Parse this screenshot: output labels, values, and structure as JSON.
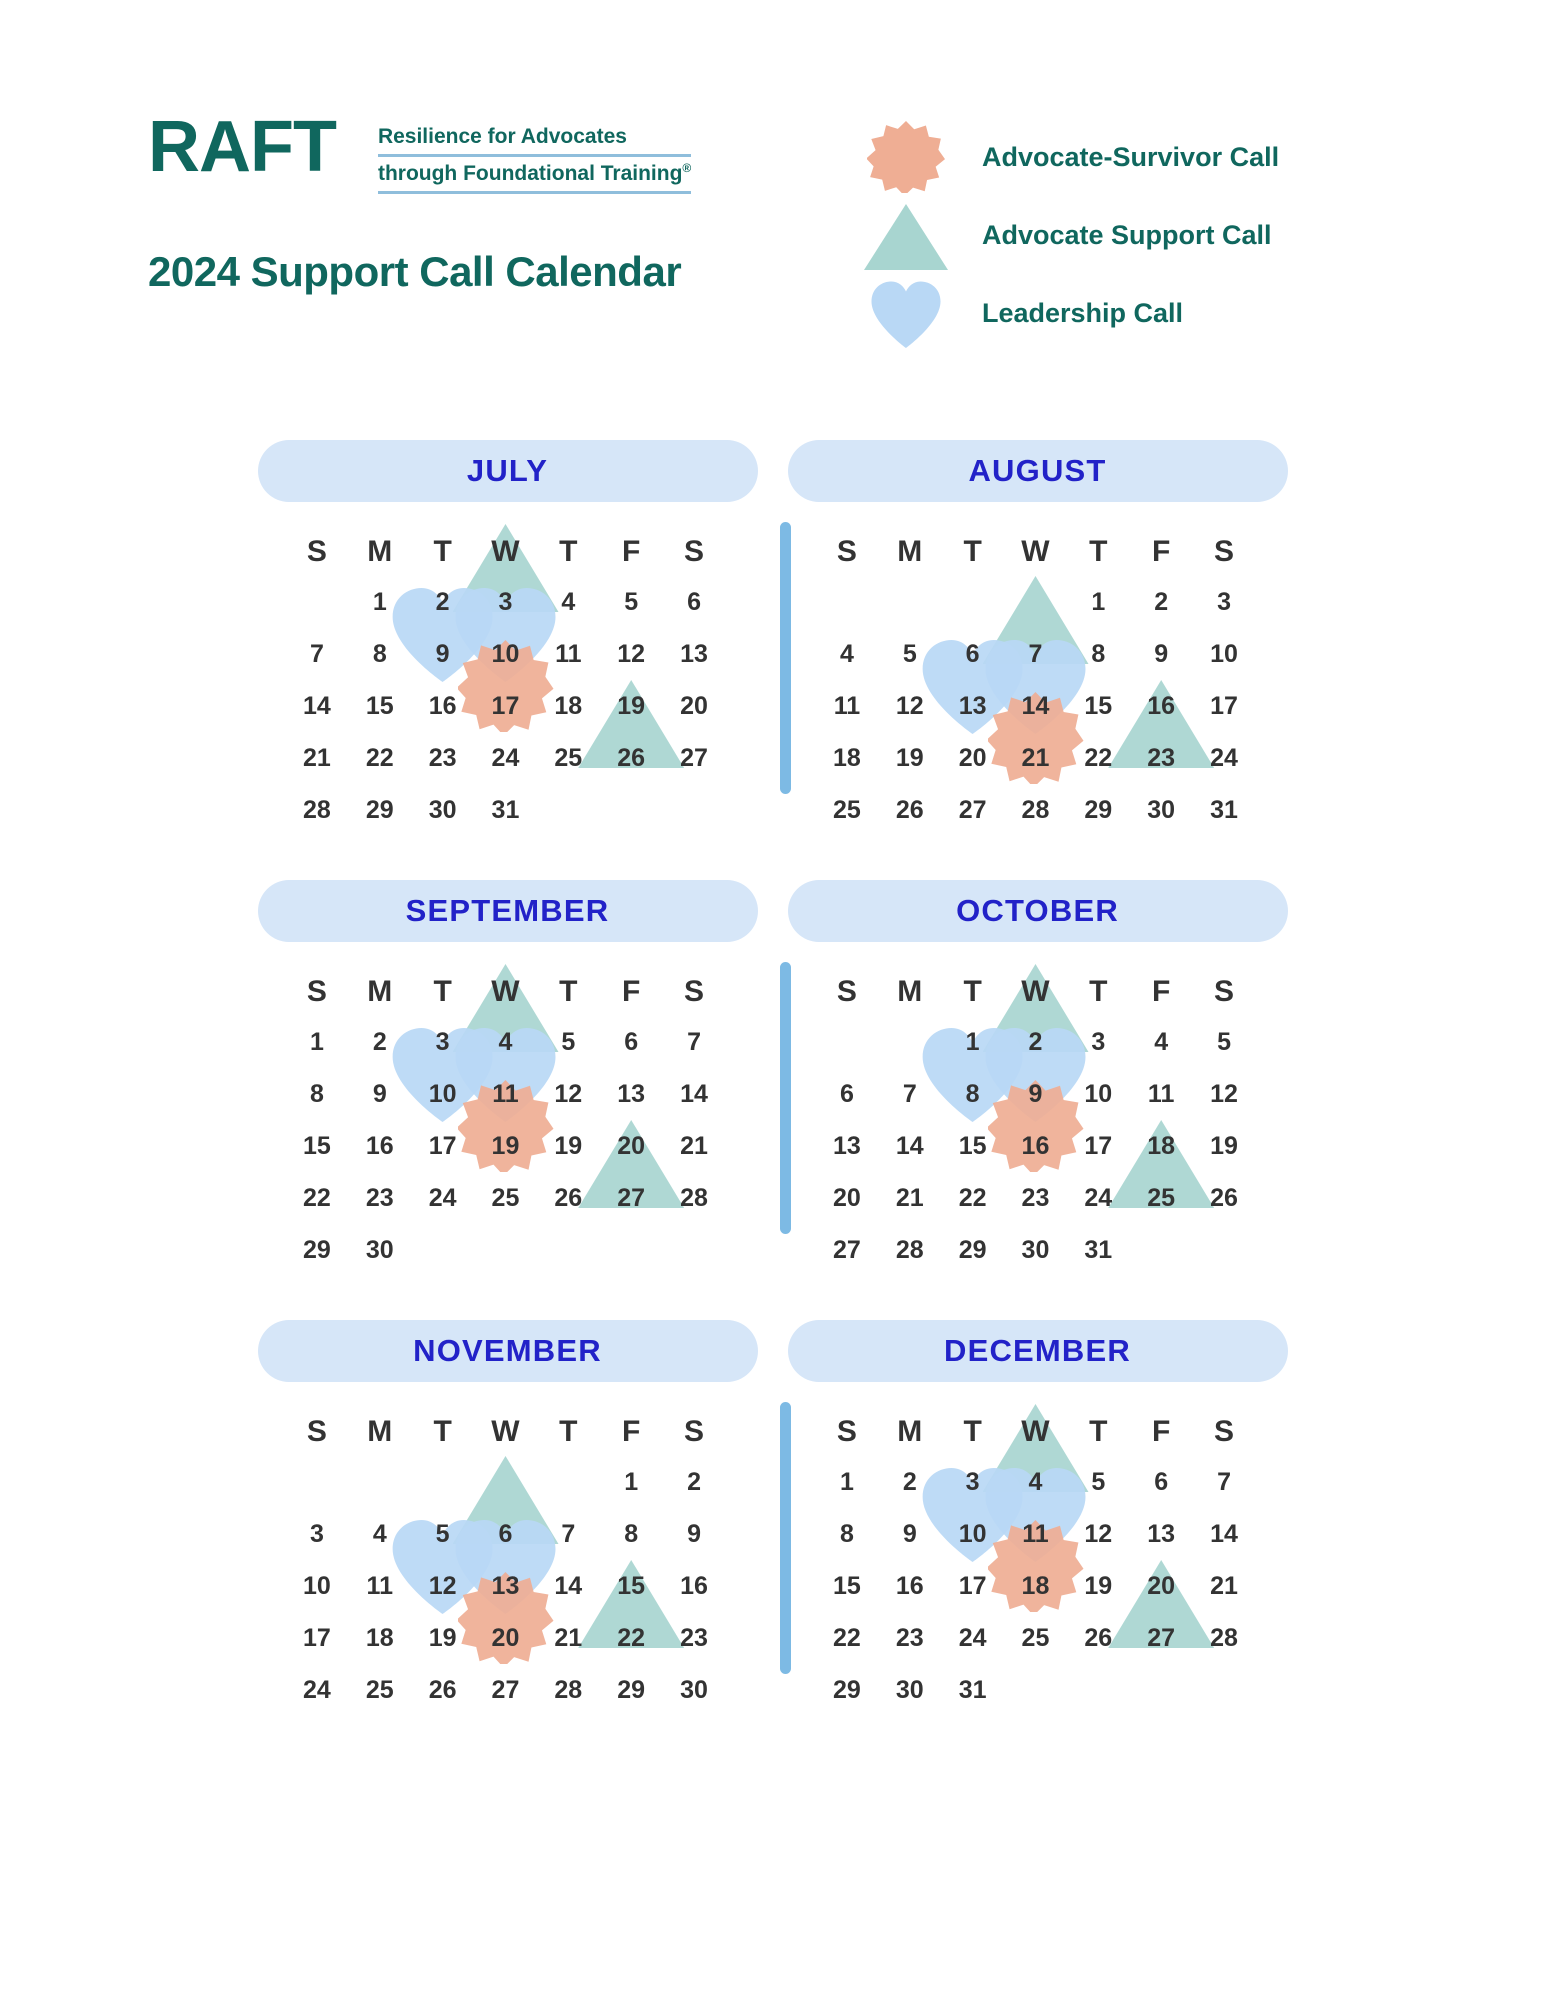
{
  "brand": {
    "logo_text": "RAFT",
    "tagline_line1": "Resilience for Advocates",
    "tagline_line2": "through Foundational Training",
    "tagline_registered": "®"
  },
  "page_title": "2024 Support Call Calendar",
  "colors": {
    "brand_teal": "#10675E",
    "month_pill_bg": "#D6E6F8",
    "month_name": "#2222C8",
    "divider": "#7DBAE4",
    "starburst": "#EFAE94",
    "triangle": "#A8D5D0",
    "heart": "#B9D8F5",
    "day_text": "#333333",
    "tagline_rule": "#8FBEDC"
  },
  "legend": {
    "items": [
      {
        "icon": "starburst-icon",
        "label": "Advocate-Survivor Call",
        "color": "#EFAE94"
      },
      {
        "icon": "triangle-icon",
        "label": "Advocate Support Call",
        "color": "#A8D5D0"
      },
      {
        "icon": "heart-icon",
        "label": "Leadership Call",
        "color": "#B9D8F5"
      }
    ]
  },
  "weekday_headers": [
    "S",
    "M",
    "T",
    "W",
    "T",
    "F",
    "S"
  ],
  "months": [
    {
      "name": "JULY",
      "has_divider": false,
      "weeks": [
        [
          "",
          "1",
          "2",
          "3",
          "4",
          "5",
          "6"
        ],
        [
          "7",
          "8",
          "9",
          "10",
          "11",
          "12",
          "13"
        ],
        [
          "14",
          "15",
          "16",
          "17",
          "18",
          "19",
          "20"
        ],
        [
          "21",
          "22",
          "23",
          "24",
          "25",
          "26",
          "27"
        ],
        [
          "28",
          "29",
          "30",
          "31",
          "",
          "",
          ""
        ]
      ],
      "markers": [
        {
          "type": "triangle",
          "day": "3",
          "row": 0,
          "col": 3
        },
        {
          "type": "heart",
          "day": "9",
          "row": 1,
          "col": 2
        },
        {
          "type": "heart",
          "day": "10",
          "row": 1,
          "col": 3
        },
        {
          "type": "starburst",
          "day": "17",
          "row": 2,
          "col": 3
        },
        {
          "type": "triangle",
          "day": "26",
          "row": 3,
          "col": 5
        }
      ]
    },
    {
      "name": "AUGUST",
      "has_divider": true,
      "weeks": [
        [
          "",
          "",
          "",
          "",
          "1",
          "2",
          "3"
        ],
        [
          "4",
          "5",
          "6",
          "7",
          "8",
          "9",
          "10"
        ],
        [
          "11",
          "12",
          "13",
          "14",
          "15",
          "16",
          "17"
        ],
        [
          "18",
          "19",
          "20",
          "21",
          "22",
          "23",
          "24"
        ],
        [
          "25",
          "26",
          "27",
          "28",
          "29",
          "30",
          "31"
        ]
      ],
      "markers": [
        {
          "type": "triangle",
          "day": "7",
          "row": 1,
          "col": 3
        },
        {
          "type": "heart",
          "day": "13",
          "row": 2,
          "col": 2
        },
        {
          "type": "heart",
          "day": "14",
          "row": 2,
          "col": 3
        },
        {
          "type": "starburst",
          "day": "21",
          "row": 3,
          "col": 3
        },
        {
          "type": "triangle",
          "day": "23",
          "row": 3,
          "col": 5
        }
      ]
    },
    {
      "name": "SEPTEMBER",
      "has_divider": false,
      "weeks": [
        [
          "1",
          "2",
          "3",
          "4",
          "5",
          "6",
          "7"
        ],
        [
          "8",
          "9",
          "10",
          "11",
          "12",
          "13",
          "14"
        ],
        [
          "15",
          "16",
          "17",
          "19",
          "19",
          "20",
          "21"
        ],
        [
          "22",
          "23",
          "24",
          "25",
          "26",
          "27",
          "28"
        ],
        [
          "29",
          "30",
          "",
          "",
          "",
          "",
          ""
        ]
      ],
      "markers": [
        {
          "type": "triangle",
          "day": "4",
          "row": 0,
          "col": 3
        },
        {
          "type": "heart",
          "day": "10",
          "row": 1,
          "col": 2
        },
        {
          "type": "heart",
          "day": "11",
          "row": 1,
          "col": 3
        },
        {
          "type": "starburst",
          "day": "19",
          "row": 2,
          "col": 3
        },
        {
          "type": "triangle",
          "day": "27",
          "row": 3,
          "col": 5
        }
      ]
    },
    {
      "name": "OCTOBER",
      "has_divider": true,
      "weeks": [
        [
          "",
          "",
          "1",
          "2",
          "3",
          "4",
          "5"
        ],
        [
          "6",
          "7",
          "8",
          "9",
          "10",
          "11",
          "12"
        ],
        [
          "13",
          "14",
          "15",
          "16",
          "17",
          "18",
          "19"
        ],
        [
          "20",
          "21",
          "22",
          "23",
          "24",
          "25",
          "26"
        ],
        [
          "27",
          "28",
          "29",
          "30",
          "31",
          "",
          ""
        ]
      ],
      "markers": [
        {
          "type": "triangle",
          "day": "2",
          "row": 0,
          "col": 3
        },
        {
          "type": "heart",
          "day": "8",
          "row": 1,
          "col": 2
        },
        {
          "type": "heart",
          "day": "9",
          "row": 1,
          "col": 3
        },
        {
          "type": "starburst",
          "day": "16",
          "row": 2,
          "col": 3
        },
        {
          "type": "triangle",
          "day": "25",
          "row": 3,
          "col": 5
        }
      ]
    },
    {
      "name": "NOVEMBER",
      "has_divider": false,
      "weeks": [
        [
          "",
          "",
          "",
          "",
          "",
          "1",
          "2"
        ],
        [
          "3",
          "4",
          "5",
          "6",
          "7",
          "8",
          "9"
        ],
        [
          "10",
          "11",
          "12",
          "13",
          "14",
          "15",
          "16"
        ],
        [
          "17",
          "18",
          "19",
          "20",
          "21",
          "22",
          "23"
        ],
        [
          "24",
          "25",
          "26",
          "27",
          "28",
          "29",
          "30"
        ]
      ],
      "markers": [
        {
          "type": "triangle",
          "day": "6",
          "row": 1,
          "col": 3
        },
        {
          "type": "heart",
          "day": "12",
          "row": 2,
          "col": 2
        },
        {
          "type": "heart",
          "day": "13",
          "row": 2,
          "col": 3
        },
        {
          "type": "starburst",
          "day": "20",
          "row": 3,
          "col": 3
        },
        {
          "type": "triangle",
          "day": "22",
          "row": 3,
          "col": 5
        }
      ]
    },
    {
      "name": "DECEMBER",
      "has_divider": true,
      "weeks": [
        [
          "1",
          "2",
          "3",
          "4",
          "5",
          "6",
          "7"
        ],
        [
          "8",
          "9",
          "10",
          "11",
          "12",
          "13",
          "14"
        ],
        [
          "15",
          "16",
          "17",
          "18",
          "19",
          "20",
          "21"
        ],
        [
          "22",
          "23",
          "24",
          "25",
          "26",
          "27",
          "28"
        ],
        [
          "29",
          "30",
          "31",
          "",
          "",
          "",
          ""
        ]
      ],
      "markers": [
        {
          "type": "triangle",
          "day": "4",
          "row": 0,
          "col": 3
        },
        {
          "type": "heart",
          "day": "10",
          "row": 1,
          "col": 2
        },
        {
          "type": "heart",
          "day": "11",
          "row": 1,
          "col": 3
        },
        {
          "type": "starburst",
          "day": "18",
          "row": 2,
          "col": 3
        },
        {
          "type": "triangle",
          "day": "27",
          "row": 3,
          "col": 5
        }
      ]
    }
  ]
}
